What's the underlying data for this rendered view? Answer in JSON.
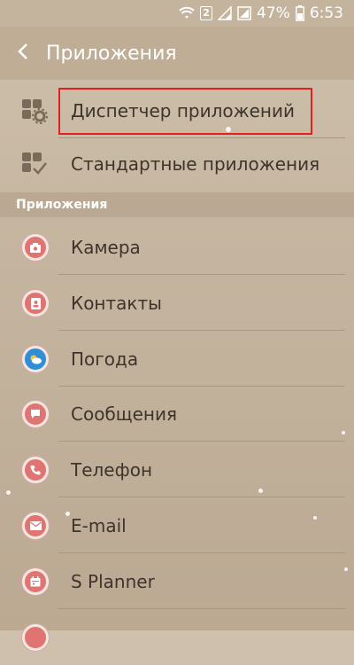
{
  "status_bar": {
    "sim": "2",
    "battery": "47%",
    "time": "6:53",
    "icons": [
      "wifi-icon",
      "sim-2-icon",
      "signal-icon",
      "signal-icon",
      "battery-icon"
    ]
  },
  "app_bar": {
    "back_icon": "chevron-left-icon",
    "title": "Приложения"
  },
  "top_items": [
    {
      "label": "Диспетчер приложений",
      "icon": "apps-gear-icon"
    },
    {
      "label": "Стандартные приложения",
      "icon": "apps-check-icon"
    }
  ],
  "section": {
    "title": "Приложения"
  },
  "apps": [
    {
      "label": "Камера",
      "icon": "camera-icon",
      "color": "#e07472"
    },
    {
      "label": "Контакты",
      "icon": "contacts-icon",
      "color": "#e07472"
    },
    {
      "label": "Погода",
      "icon": "weather-icon",
      "color": "#2f8ed6"
    },
    {
      "label": "Сообщения",
      "icon": "message-icon",
      "color": "#e07472"
    },
    {
      "label": "Телефон",
      "icon": "phone-icon",
      "color": "#e07472"
    },
    {
      "label": "E-mail",
      "icon": "email-icon",
      "color": "#e07472"
    },
    {
      "label": "S Planner",
      "icon": "calendar-icon",
      "color": "#e07472"
    }
  ]
}
